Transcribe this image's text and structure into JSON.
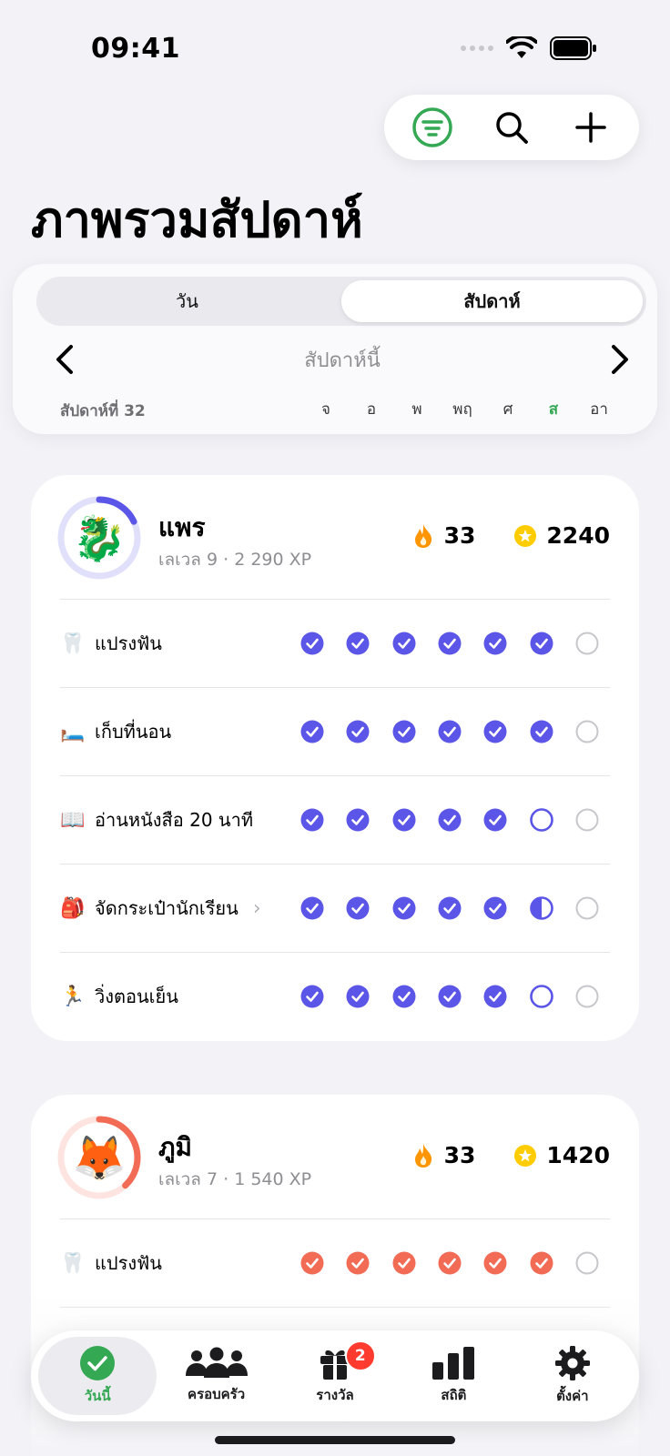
{
  "status_bar": {
    "time": "09:41"
  },
  "page": {
    "title": "ภาพรวมสัปดาห์"
  },
  "segments": [
    {
      "label": "วัน",
      "active": false
    },
    {
      "label": "สัปดาห์",
      "active": true
    }
  ],
  "week": {
    "label": "สัปดาห์นี้",
    "number": "สัปดาห์ที่ 32",
    "days": [
      "จ",
      "อ",
      "พ",
      "พฤ",
      "ศ",
      "ส",
      "อา"
    ],
    "today_index": 5
  },
  "colors": {
    "accent_green": "#34a853",
    "member1": "#5b55e8",
    "member2": "#f26b55",
    "flame": "#ff9500",
    "star": "#ffcc00"
  },
  "members": [
    {
      "name": "แพร",
      "level": "เลเวล 9 · 2 290 XP",
      "streak": "33",
      "points": "2240",
      "avatar": "🐉",
      "level_progress": 0.18,
      "color": "#5b55e8",
      "chores": [
        {
          "emoji": "🦷",
          "label": "แปรงฟัน",
          "has_chevron": false,
          "status": [
            "done",
            "done",
            "done",
            "done",
            "done",
            "done",
            "empty"
          ]
        },
        {
          "emoji": "🛏️",
          "label": "เก็บที่นอน",
          "has_chevron": false,
          "status": [
            "done",
            "done",
            "done",
            "done",
            "done",
            "done",
            "empty"
          ]
        },
        {
          "emoji": "📖",
          "label": "อ่านหนังสือ 20 นาที",
          "has_chevron": false,
          "status": [
            "done",
            "done",
            "done",
            "done",
            "done",
            "pending",
            "empty"
          ]
        },
        {
          "emoji": "🎒",
          "label": "จัดกระเป๋านักเรียน",
          "has_chevron": true,
          "status": [
            "done",
            "done",
            "done",
            "done",
            "done",
            "half",
            "empty"
          ]
        },
        {
          "emoji": "🏃",
          "label": "วิ่งตอนเย็น",
          "has_chevron": false,
          "status": [
            "done",
            "done",
            "done",
            "done",
            "done",
            "pending",
            "empty"
          ]
        }
      ]
    },
    {
      "name": "ภูมิ",
      "level": "เลเวล 7 · 1 540 XP",
      "streak": "33",
      "points": "1420",
      "avatar": "🦊",
      "level_progress": 0.38,
      "color": "#f26b55",
      "chores": [
        {
          "emoji": "🦷",
          "label": "แปรงฟัน",
          "has_chevron": false,
          "status": [
            "done",
            "done",
            "done",
            "done",
            "done",
            "done",
            "empty"
          ]
        }
      ]
    }
  ],
  "tabs": [
    {
      "label": "วันนี้",
      "icon": "checkmark-circle-icon",
      "active": true
    },
    {
      "label": "ครอบครัว",
      "icon": "people-icon",
      "active": false
    },
    {
      "label": "รางวัล",
      "icon": "gift-icon",
      "active": false,
      "badge": "2"
    },
    {
      "label": "สถิติ",
      "icon": "bar-chart-icon",
      "active": false
    },
    {
      "label": "ตั้งค่า",
      "icon": "gear-icon",
      "active": false
    }
  ]
}
